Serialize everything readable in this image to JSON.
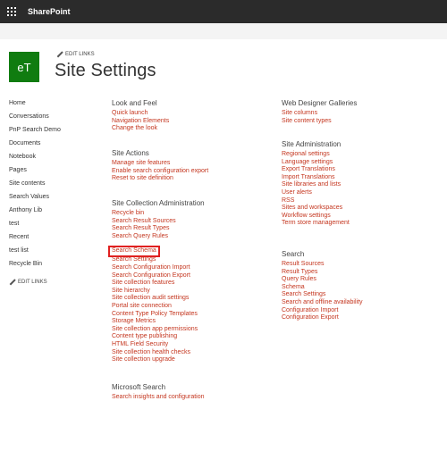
{
  "suitebar": {
    "brand": "SharePoint"
  },
  "site": {
    "logo_text": "eT",
    "edit_links": "EDIT LINKS",
    "title": "Site Settings"
  },
  "leftnav": {
    "items": [
      "Home",
      "Conversations",
      "PnP Search Demo",
      "Documents",
      "Notebook",
      "Pages",
      "Site contents",
      "Search Values",
      "Anthony Lib",
      "test",
      "Recent",
      "test list",
      "Recycle Bin"
    ],
    "edit_links": "EDIT LINKS"
  },
  "col1": [
    {
      "title": "Look and Feel",
      "links": [
        "Quick launch",
        "Navigation Elements",
        "Change the look"
      ]
    },
    {
      "title": "Site Actions",
      "links": [
        "Manage site features",
        "Enable search configuration export",
        "Reset to site definition"
      ]
    },
    {
      "title": "Site Collection Administration",
      "links": [
        "Recycle bin",
        "Search Result Sources",
        "Search Result Types",
        "Search Query Rules",
        "Search Schema",
        "Search Settings",
        "Search Configuration Import",
        "Search Configuration Export",
        "Site collection features",
        "Site hierarchy",
        "Site collection audit settings",
        "Portal site connection",
        "Content Type Policy Templates",
        "Storage Metrics",
        "Site collection app permissions",
        "Content type publishing",
        "HTML Field Security",
        "Site collection health checks",
        "Site collection upgrade"
      ]
    },
    {
      "title": "Microsoft Search",
      "links": [
        "Search insights and configuration"
      ]
    }
  ],
  "col2": [
    {
      "title": "Web Designer Galleries",
      "links": [
        "Site columns",
        "Site content types"
      ]
    },
    {
      "title": "Site Administration",
      "links": [
        "Regional settings",
        "Language settings",
        "Export Translations",
        "Import Translations",
        "Site libraries and lists",
        "User alerts",
        "RSS",
        "Sites and workspaces",
        "Workflow settings",
        "Term store management"
      ]
    },
    {
      "title": "Search",
      "links": [
        "Result Sources",
        "Result Types",
        "Query Rules",
        "Schema",
        "Search Settings",
        "Search and offline availability",
        "Configuration Import",
        "Configuration Export"
      ]
    }
  ],
  "highlighted_link": "Search Schema",
  "colors": {
    "link": "#c4361f",
    "suitebar": "#2b2b2b",
    "logo": "#107c10",
    "highlight": "#e02020"
  }
}
